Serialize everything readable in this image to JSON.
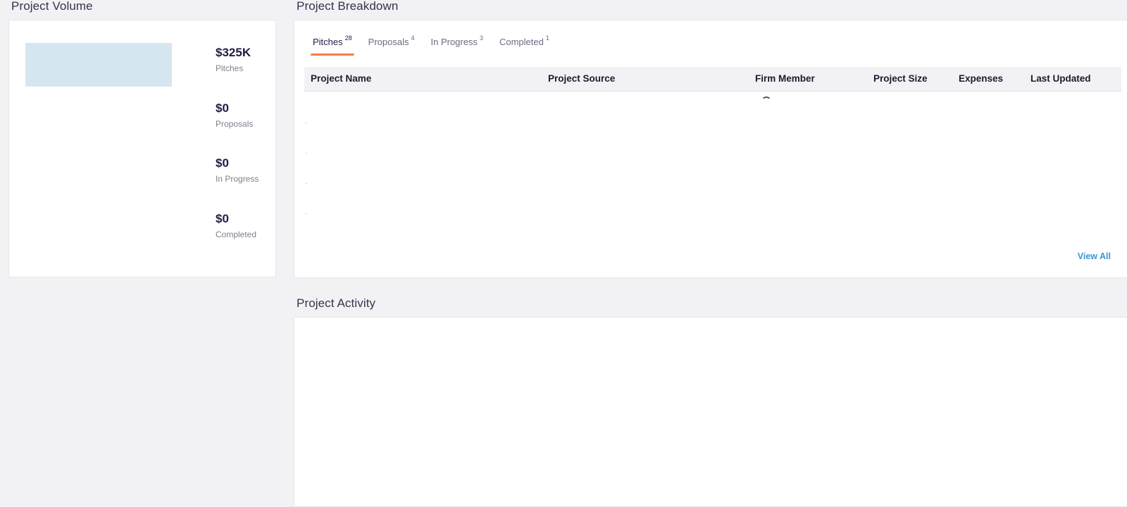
{
  "volume": {
    "title": "Project Volume",
    "stats": [
      {
        "value": "$325K",
        "label": "Pitches"
      },
      {
        "value": "$0",
        "label": "Proposals"
      },
      {
        "value": "$0",
        "label": "In Progress"
      },
      {
        "value": "$0",
        "label": "Completed"
      }
    ],
    "bar_color": "#d6e6f1"
  },
  "breakdown": {
    "title": "Project Breakdown",
    "tabs": [
      {
        "label": "Pitches",
        "count": "28",
        "active": true
      },
      {
        "label": "Proposals",
        "count": "4",
        "active": false
      },
      {
        "label": "In Progress",
        "count": "3",
        "active": false
      },
      {
        "label": "Completed",
        "count": "1",
        "active": false
      }
    ],
    "columns": [
      "Project Name",
      "Project Source",
      "Firm Member",
      "Project Size",
      "Expenses",
      "Last Updated"
    ],
    "view_all_label": "View All",
    "loading_icon": "spinner-icon"
  },
  "activity": {
    "title": "Project Activity"
  },
  "colors": {
    "accent": "#f47f47",
    "link": "#3a97d4",
    "background": "#f2f2f4"
  }
}
